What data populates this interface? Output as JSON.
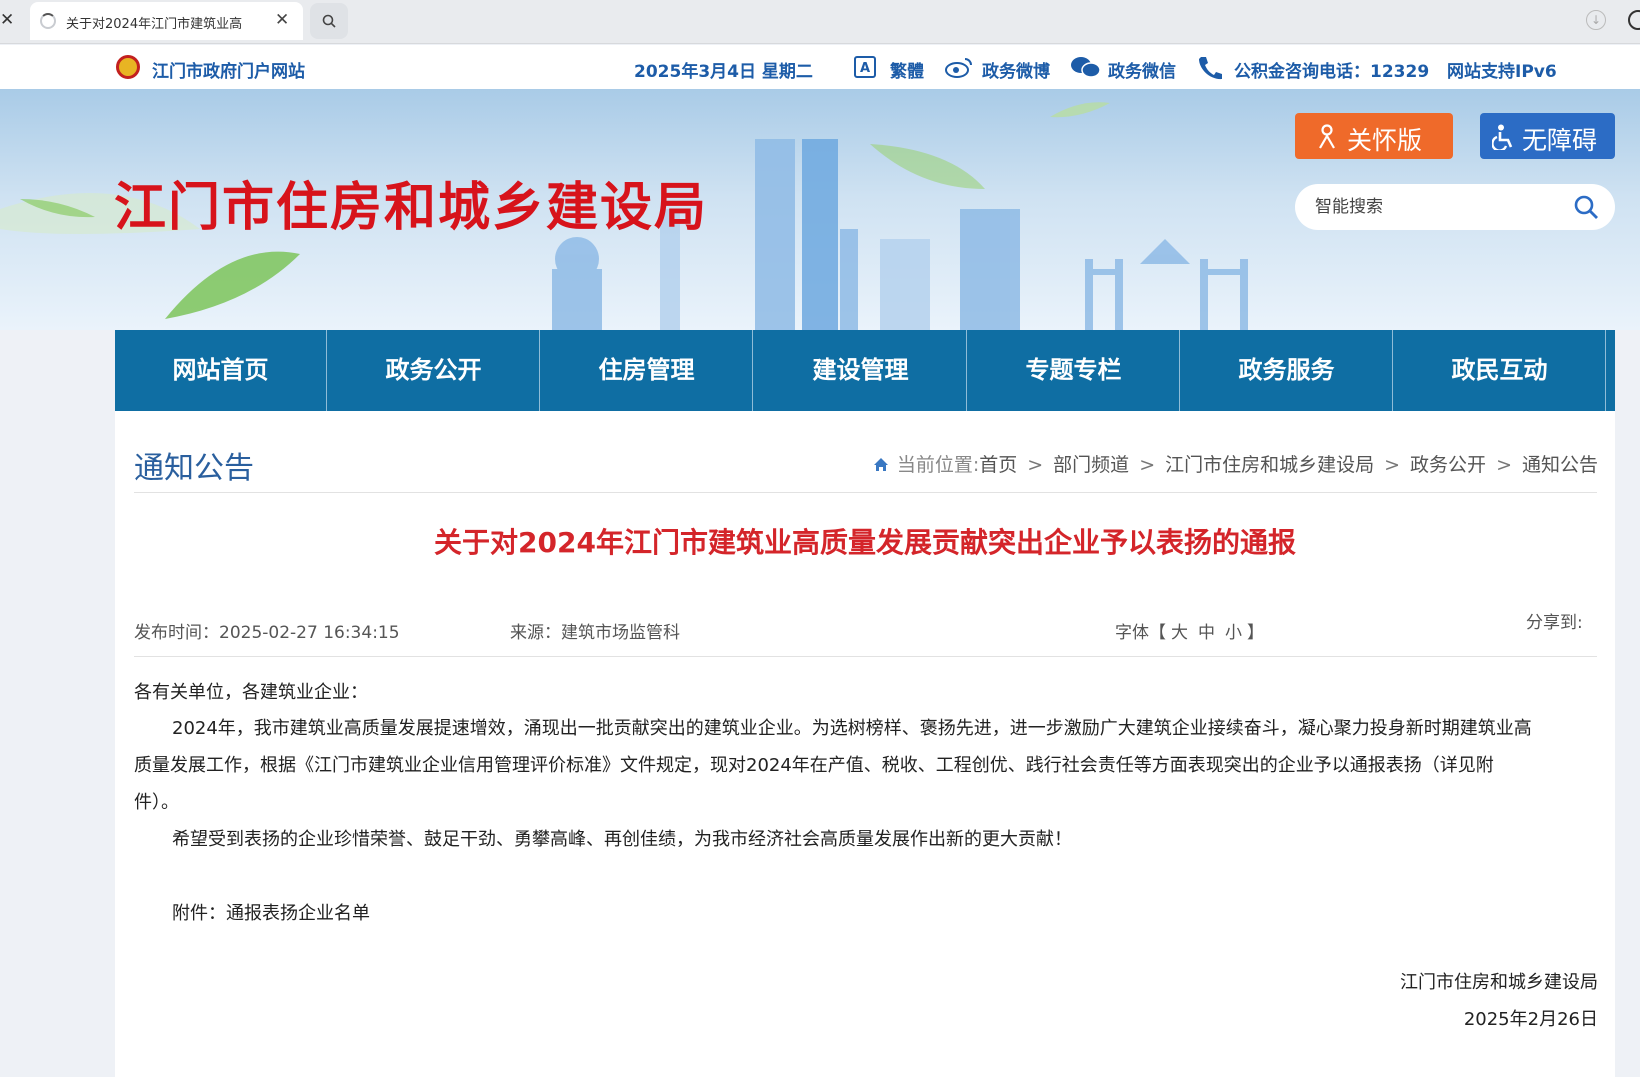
{
  "browser": {
    "tab_title": "关于对2024年江门市建筑业高",
    "close_window": "✕",
    "close_tab": "✕"
  },
  "topbar": {
    "portal": "江门市政府门户网站",
    "date": "2025年3月4日 星期二",
    "traditional": "繁體",
    "weibo": "政务微博",
    "wechat": "政务微信",
    "hotline": "公积金咨询电话：12329",
    "ipv6": "网站支持IPv6"
  },
  "banner": {
    "title": "江门市住房和城乡建设局",
    "care_button": "关怀版",
    "accessibility_button": "无障碍",
    "search_placeholder": "智能搜索"
  },
  "nav": [
    {
      "label": "网站首页"
    },
    {
      "label": "政务公开"
    },
    {
      "label": "住房管理"
    },
    {
      "label": "建设管理"
    },
    {
      "label": "专题专栏"
    },
    {
      "label": "政务服务"
    },
    {
      "label": "政民互动"
    }
  ],
  "content": {
    "section_title": "通知公告",
    "breadcrumb": {
      "prefix": "当前位置:",
      "items": [
        "首页",
        "部门频道",
        "江门市住房和城乡建设局",
        "政务公开",
        "通知公告"
      ],
      "separator": ">"
    },
    "article_title": "关于对2024年江门市建筑业高质量发展贡献突出企业予以表扬的通报",
    "publish_time": "发布时间：2025-02-27 16:34:15",
    "source": "来源：建筑市场监管科",
    "font_label": "字体【",
    "font_large": "大",
    "font_medium": "中",
    "font_small": "小",
    "font_close": "】",
    "share_label": "分享到:",
    "greeting": "各有关单位，各建筑业企业：",
    "paragraph1_line1": "2024年，我市建筑业高质量发展提速增效，涌现出一批贡献突出的建筑业企业。为选树榜样、褒扬先进，进一步激励广大建筑企业接续奋斗，凝心聚力投身新时期建筑业高",
    "paragraph1_line2": "质量发展工作，根据《江门市建筑业企业信用管理评价标准》文件规定，现对2024年在产值、税收、工程创优、践行社会责任等方面表现突出的企业予以通报表扬（详见附",
    "paragraph1_line3": "件）。",
    "paragraph2": "希望受到表扬的企业珍惜荣誉、鼓足干劲、勇攀高峰、再创佳绩，为我市经济社会高质量发展作出新的更大贡献！",
    "attachment": "附件：通报表扬企业名单",
    "signature_org": "江门市住房和城乡建设局",
    "signature_date": "2025年2月26日"
  }
}
